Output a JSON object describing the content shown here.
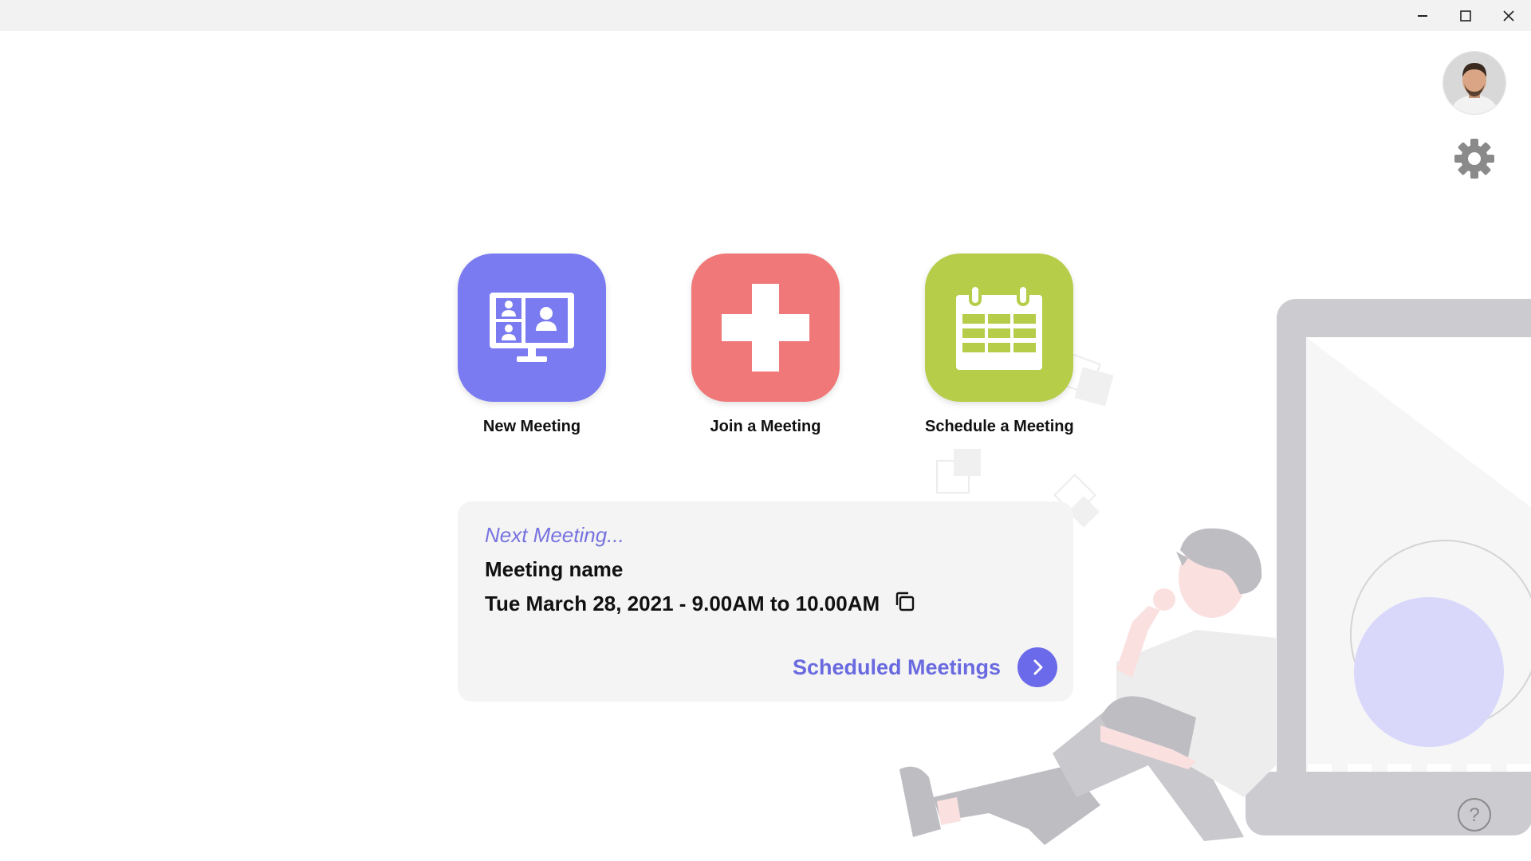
{
  "window_controls": {
    "minimize_icon": "minimize-icon",
    "maximize_icon": "maximize-icon",
    "close_icon": "close-icon"
  },
  "user": {
    "avatar_icon": "user-avatar"
  },
  "actions": [
    {
      "label": "New Meeting",
      "icon": "video-conference-icon",
      "color": "#7b7bf1"
    },
    {
      "label": "Join a Meeting",
      "icon": "plus-icon",
      "color": "#f07878"
    },
    {
      "label": "Schedule a Meeting",
      "icon": "calendar-icon",
      "color": "#b5cd49"
    }
  ],
  "next_meeting": {
    "heading": "Next Meeting...",
    "name": "Meeting name",
    "time": "Tue March 28, 2021 - 9.00AM to 10.00AM",
    "copy_icon": "copy-icon",
    "link_label": "Scheduled Meetings",
    "link_icon": "chevron-right-icon"
  },
  "help_icon": "question-mark-icon",
  "colors": {
    "accent": "#6a6ae0",
    "titlebar": "#f2f2f2",
    "card_bg": "#f4f4f4"
  }
}
